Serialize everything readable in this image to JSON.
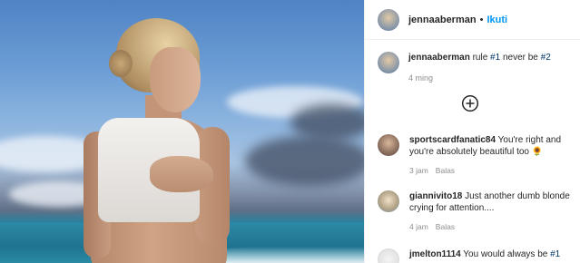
{
  "post": {
    "username": "jennaaberman",
    "separator": "•",
    "follow_label": "Ikuti"
  },
  "caption": {
    "username": "jennaaberman",
    "text_before": " rule ",
    "tag1": "#1",
    "text_middle": " never be ",
    "tag2": "#2",
    "time": "4 ming"
  },
  "load_more_icon": "plus-circle-icon",
  "comments": [
    {
      "username": "sportscardfanatic84",
      "text": " You're right and you're absolutely beautiful too 🌻",
      "time": "3 jam",
      "reply_label": "Balas"
    },
    {
      "username": "giannivito18",
      "text": " Just another dumb blonde crying for attention....",
      "time": "4 jam",
      "reply_label": "Balas"
    },
    {
      "username": "jmelton1114",
      "text": " You would always be ",
      "tag": "#1"
    }
  ],
  "colors": {
    "link_blue": "#0095f6",
    "hashtag": "#00376b",
    "meta_gray": "#8e8e8e"
  }
}
